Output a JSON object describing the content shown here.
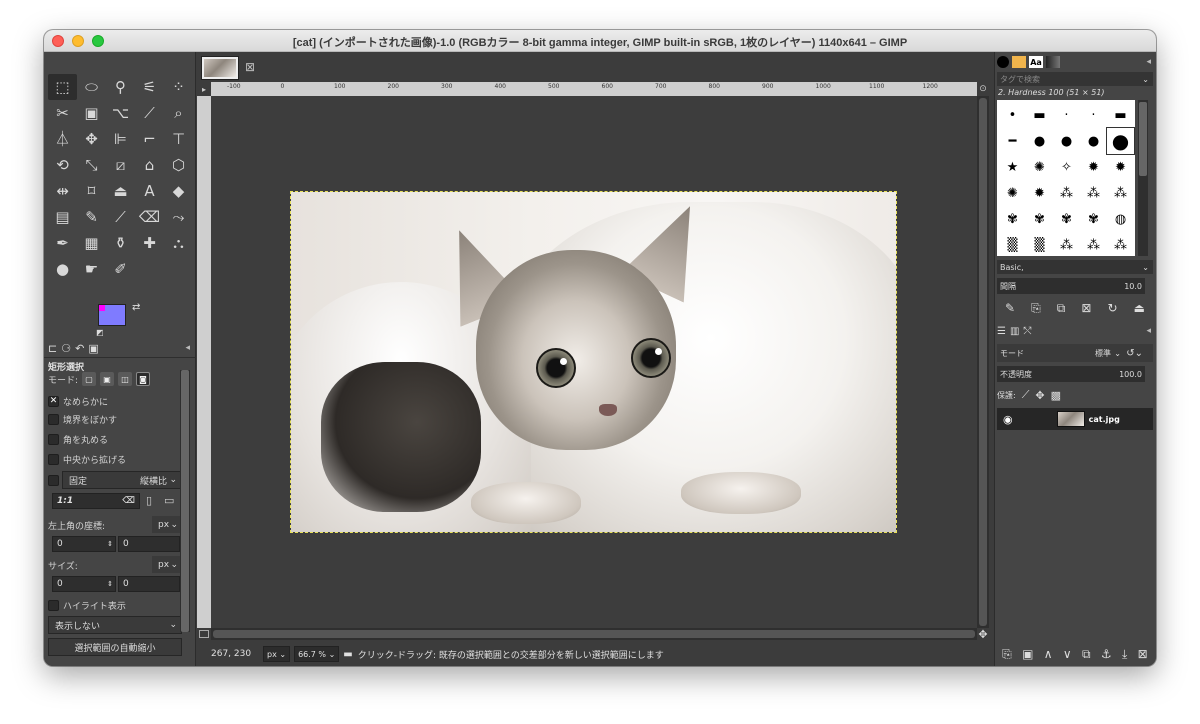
{
  "window": {
    "title": "[cat] (インポートされた画像)-1.0 (RGBカラー 8-bit gamma integer, GIMP built-in sRGB, 1枚のレイヤー) 1140x641 – GIMP"
  },
  "toolbox": {
    "tools": [
      {
        "icon": "rect-select-icon",
        "glyph": "⬚"
      },
      {
        "icon": "ellipse-select-icon",
        "glyph": "⬭"
      },
      {
        "icon": "free-select-icon",
        "glyph": "⚲"
      },
      {
        "icon": "fuzzy-select-icon",
        "glyph": "⚟"
      },
      {
        "icon": "select-by-color-icon",
        "glyph": "⁘"
      },
      {
        "icon": "scissors-select-icon",
        "glyph": "✂"
      },
      {
        "icon": "foreground-select-icon",
        "glyph": "▣"
      },
      {
        "icon": "paths-icon",
        "glyph": "⌥"
      },
      {
        "icon": "color-picker-icon",
        "glyph": "⟋"
      },
      {
        "icon": "zoom-icon",
        "glyph": "⌕"
      },
      {
        "icon": "measure-icon",
        "glyph": "⏃"
      },
      {
        "icon": "move-icon",
        "glyph": "✥"
      },
      {
        "icon": "align-icon",
        "glyph": "⊫"
      },
      {
        "icon": "crop-icon",
        "glyph": "⌐"
      },
      {
        "icon": "unified-transform-icon",
        "glyph": "⊤"
      },
      {
        "icon": "rotate-icon",
        "glyph": "⟲"
      },
      {
        "icon": "scale-icon",
        "glyph": "⤡"
      },
      {
        "icon": "shear-icon",
        "glyph": "⧄"
      },
      {
        "icon": "perspective-icon",
        "glyph": "⌂"
      },
      {
        "icon": "3d-transform-icon",
        "glyph": "⬡"
      },
      {
        "icon": "flip-icon",
        "glyph": "⇹"
      },
      {
        "icon": "cage-transform-icon",
        "glyph": "⌑"
      },
      {
        "icon": "warp-transform-icon",
        "glyph": "⏏"
      },
      {
        "icon": "text-icon",
        "glyph": "A"
      },
      {
        "icon": "bucket-fill-icon",
        "glyph": "◆"
      },
      {
        "icon": "gradient-icon",
        "glyph": "▤"
      },
      {
        "icon": "pencil-icon",
        "glyph": "✎"
      },
      {
        "icon": "paintbrush-icon",
        "glyph": "⟋"
      },
      {
        "icon": "eraser-icon",
        "glyph": "⌫"
      },
      {
        "icon": "airbrush-icon",
        "glyph": "⤳"
      },
      {
        "icon": "ink-icon",
        "glyph": "✒"
      },
      {
        "icon": "mypaint-brush-icon",
        "glyph": "▦"
      },
      {
        "icon": "clone-icon",
        "glyph": "⚱"
      },
      {
        "icon": "heal-icon",
        "glyph": "✚"
      },
      {
        "icon": "perspective-clone-icon",
        "glyph": "⛬"
      },
      {
        "icon": "blur-sharpen-icon",
        "glyph": "●"
      },
      {
        "icon": "smudge-icon",
        "glyph": "☛"
      },
      {
        "icon": "dodge-burn-icon",
        "glyph": "✐"
      }
    ],
    "tabs": [
      {
        "icon": "tool-options-tab-icon",
        "glyph": "⊏"
      },
      {
        "icon": "device-status-tab-icon",
        "glyph": "⚆"
      },
      {
        "icon": "undo-history-tab-icon",
        "glyph": "↶"
      },
      {
        "icon": "images-tab-icon",
        "glyph": "▣"
      }
    ],
    "options_title": "矩形選択",
    "mode_label": "モード:",
    "antialias_label": "なめらかに",
    "feather_label": "境界をぼかす",
    "rounded_label": "角を丸める",
    "expand_center_label": "中央から拡げる",
    "fixed_label": "固定",
    "fixed_mode": "縦横比",
    "ratio_value": "1:1",
    "position_label": "左上角の座標:",
    "position_unit": "px",
    "pos_x": "0",
    "pos_y": "0",
    "size_label": "サイズ:",
    "size_unit": "px",
    "size_w": "0",
    "size_h": "0",
    "highlight_label": "ハイライト表示",
    "guides_value": "表示しない",
    "auto_shrink_label": "選択範囲の自動縮小",
    "bottom_buttons": [
      {
        "icon": "save-preset-icon",
        "glyph": "⤓"
      },
      {
        "icon": "restore-preset-icon",
        "glyph": "↺"
      },
      {
        "icon": "delete-preset-icon",
        "glyph": "⊠"
      },
      {
        "icon": "reset-options-icon",
        "glyph": "⟲"
      }
    ]
  },
  "canvas": {
    "ruler_ticks": [
      "-100",
      "0",
      "100",
      "200",
      "300",
      "400",
      "500",
      "600",
      "700",
      "800",
      "900",
      "1000",
      "1100",
      "1200"
    ],
    "cursor_coords": "267, 230",
    "unit": "px",
    "zoom": "66.7 %",
    "status_message": "クリック-ドラッグ: 既存の選択範囲との交差部分を新しい選択範囲にします"
  },
  "brushes": {
    "tag_placeholder": "タグで検索",
    "brush_name": "2. Hardness 100 (51 × 51)",
    "preset": "Basic,",
    "spacing_label": "間隔",
    "spacing_value": "10.0",
    "grid": [
      "•",
      "▬",
      "·",
      "·",
      "▬",
      "━",
      "●",
      "●",
      "●",
      "●",
      "★",
      "✺",
      "✧",
      "✹",
      "✹",
      "✺",
      "✹",
      "⁂",
      "⁂",
      "⁂",
      "✾",
      "✾",
      "✾",
      "✾",
      "◍",
      "▒",
      "▒",
      "⁂",
      "⁂",
      "⁂"
    ],
    "actions": [
      {
        "icon": "edit-brush-icon",
        "glyph": "✎"
      },
      {
        "icon": "new-brush-icon",
        "glyph": "⎘"
      },
      {
        "icon": "duplicate-brush-icon",
        "glyph": "⧉"
      },
      {
        "icon": "delete-brush-icon",
        "glyph": "⊠"
      },
      {
        "icon": "refresh-brushes-icon",
        "glyph": "↻"
      },
      {
        "icon": "open-brush-as-image-icon",
        "glyph": "⏏"
      }
    ]
  },
  "layers": {
    "tabs": [
      {
        "icon": "layers-tab-icon",
        "glyph": "☰"
      },
      {
        "icon": "channels-tab-icon",
        "glyph": "▥"
      },
      {
        "icon": "paths-tab-icon",
        "glyph": "⤲"
      }
    ],
    "mode_label": "モード",
    "mode_value": "標準",
    "opacity_label": "不透明度",
    "opacity_value": "100.0",
    "lock_label": "保護:",
    "lock_icons": [
      {
        "icon": "lock-pixels-icon",
        "glyph": "⟋"
      },
      {
        "icon": "lock-position-icon",
        "glyph": "✥"
      },
      {
        "icon": "lock-alpha-icon",
        "glyph": "▩"
      }
    ],
    "items": [
      {
        "name": "cat.jpg"
      }
    ],
    "bottom_buttons": [
      {
        "icon": "new-layer-icon",
        "glyph": "⎘"
      },
      {
        "icon": "new-layer-group-icon",
        "glyph": "▣"
      },
      {
        "icon": "raise-layer-icon",
        "glyph": "∧"
      },
      {
        "icon": "lower-layer-icon",
        "glyph": "∨"
      },
      {
        "icon": "duplicate-layer-icon",
        "glyph": "⧉"
      },
      {
        "icon": "anchor-layer-icon",
        "glyph": "⚓"
      },
      {
        "icon": "merge-layer-icon",
        "glyph": "⤓"
      },
      {
        "icon": "delete-layer-icon",
        "glyph": "⊠"
      }
    ]
  }
}
